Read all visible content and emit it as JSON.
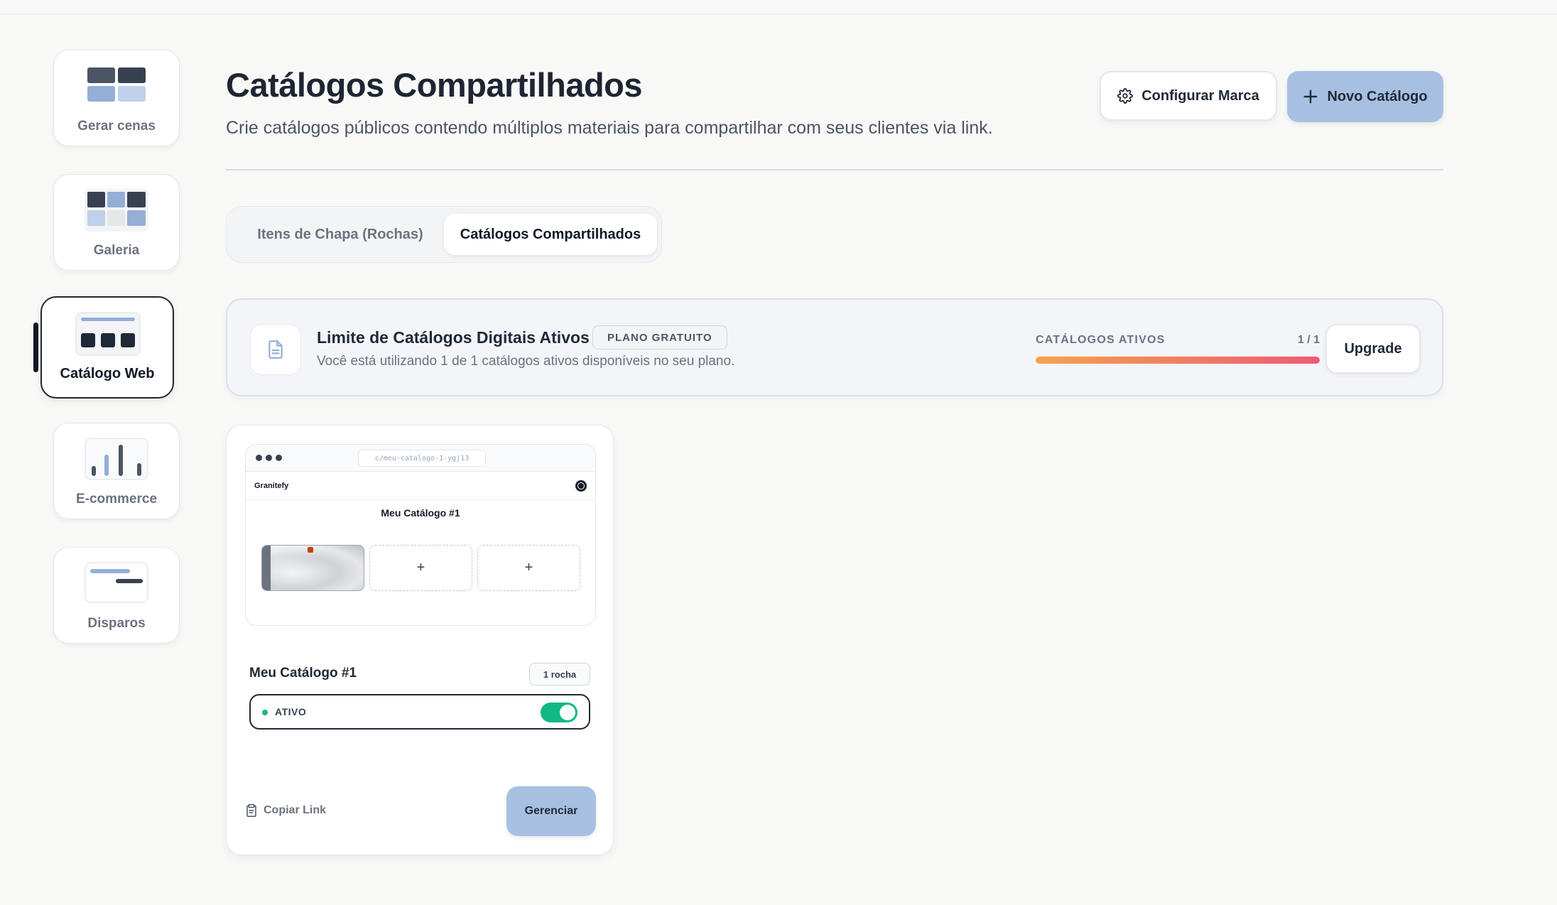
{
  "sidebar": {
    "items": [
      {
        "label": "Gerar cenas"
      },
      {
        "label": "Galeria"
      },
      {
        "label": "Catálogo Web"
      },
      {
        "label": "E-commerce"
      },
      {
        "label": "Disparos"
      }
    ]
  },
  "header": {
    "title": "Catálogos Compartilhados",
    "subtitle": "Crie catálogos públicos contendo múltiplos materiais para compartilhar com seus clientes via link.",
    "config_button": "Configurar Marca",
    "new_button": "Novo Catálogo"
  },
  "tabs": [
    {
      "label": "Itens de Chapa (Rochas)",
      "active": false
    },
    {
      "label": "Catálogos Compartilhados",
      "active": true
    }
  ],
  "limit_banner": {
    "title": "Limite de Catálogos Digitais Ativos",
    "plan_badge": "PLANO GRATUITO",
    "description": "Você está utilizando 1 de 1 catálogos ativos disponíveis no seu plano.",
    "active_label": "CATÁLOGOS ATIVOS",
    "active_count": "1 / 1",
    "progress": 1.0,
    "upgrade_button": "Upgrade"
  },
  "catalog_card": {
    "preview": {
      "url": "c/meu-catalogo-1-ygj13",
      "brand": "Granitefy",
      "title": "Meu Catálogo #1",
      "add_slots": [
        "+",
        "+"
      ]
    },
    "name": "Meu Catálogo #1",
    "count_badge": "1 rocha",
    "status": "ATIVO",
    "status_on": true,
    "copy_link": "Copiar Link",
    "manage_button": "Gerenciar"
  },
  "colors": {
    "accent": "#a7c0e2",
    "active_green": "#10b981",
    "progress_start": "#f6a24d",
    "progress_end": "#ef5a73",
    "text_dark": "#1e2533"
  }
}
